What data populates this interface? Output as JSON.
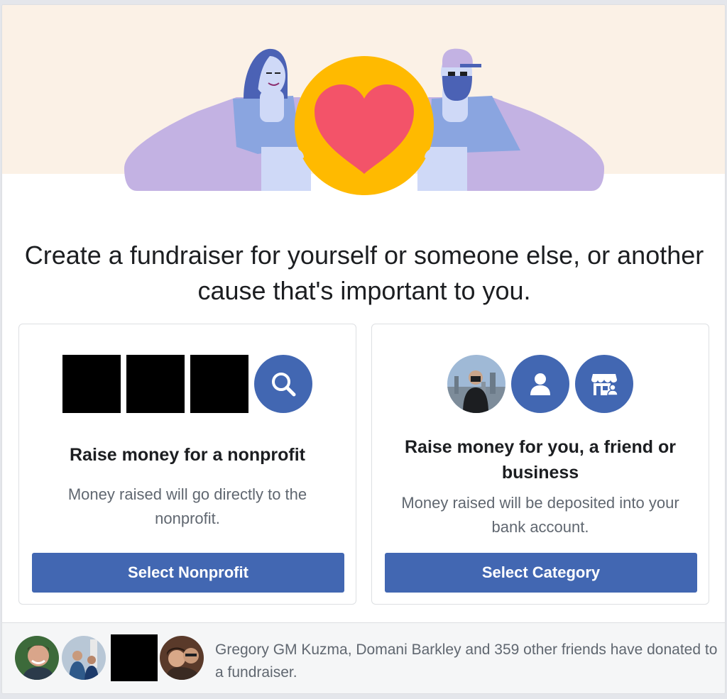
{
  "headline": "Create a fundraiser for yourself or someone else, or another cause that's important to you.",
  "nonprofit": {
    "title": "Raise money for a nonprofit",
    "description": "Money raised will go directly to the nonprofit.",
    "button": "Select Nonprofit",
    "icons": [
      "redacted-logo",
      "redacted-logo",
      "redacted-logo",
      "search-icon"
    ]
  },
  "personal": {
    "title": "Raise money for you, a friend or business",
    "description": "Money raised will be deposited into your bank account.",
    "button": "Select Category",
    "icons": [
      "user-photo",
      "person-icon",
      "business-storefront-icon"
    ]
  },
  "footer": {
    "text": "Gregory GM Kuzma, Domani Barkley and 359 other friends have donated to a fundraiser."
  },
  "colors": {
    "primary": "#4267b2",
    "hero_bg": "#fbf1e6",
    "heart": "#f35369",
    "coin": "#ffba00"
  }
}
